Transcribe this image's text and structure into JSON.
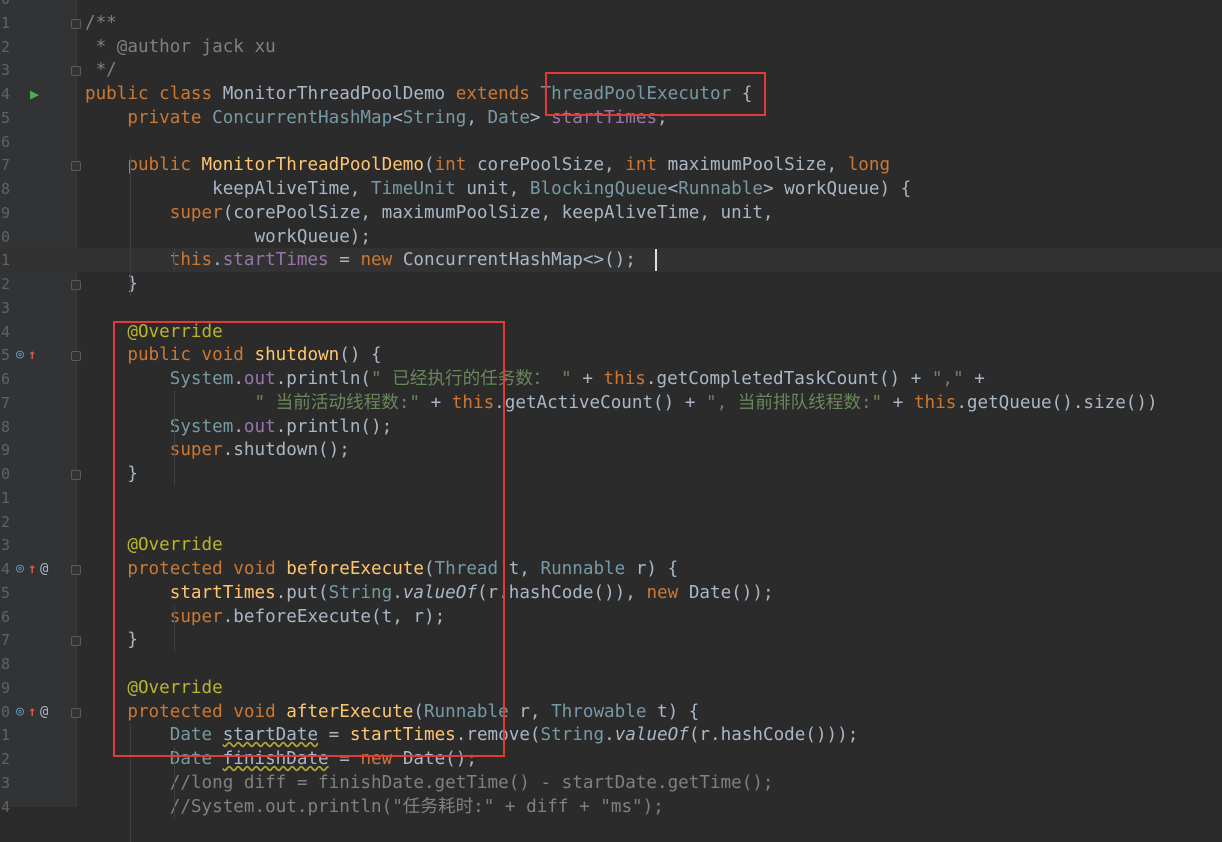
{
  "editor": {
    "lines": [
      {
        "n": "0",
        "tokens": []
      },
      {
        "n": "1",
        "tokens": [
          [
            "comment",
            "/**"
          ]
        ]
      },
      {
        "n": "2",
        "tokens": [
          [
            "comment",
            " * @author jack xu"
          ]
        ]
      },
      {
        "n": "3",
        "tokens": [
          [
            "comment",
            " */"
          ]
        ]
      },
      {
        "n": "4",
        "icons": [
          "run"
        ],
        "tokens": [
          [
            "keyword",
            "public class "
          ],
          [
            "plain",
            "MonitorThreadPoolDemo "
          ],
          [
            "keyword",
            "extends "
          ],
          [
            "class",
            "ThreadPoolExecutor"
          ],
          [
            "plain",
            " {"
          ]
        ]
      },
      {
        "n": "5",
        "tokens": [
          [
            "plain",
            "    "
          ],
          [
            "keyword",
            "private "
          ],
          [
            "class",
            "ConcurrentHashMap"
          ],
          [
            "plain",
            "<"
          ],
          [
            "class",
            "String"
          ],
          [
            "plain",
            ", "
          ],
          [
            "class",
            "Date"
          ],
          [
            "plain",
            "> "
          ],
          [
            "field",
            "startTimes"
          ],
          [
            "plain",
            ";"
          ]
        ]
      },
      {
        "n": "6",
        "tokens": []
      },
      {
        "n": "7",
        "tokens": [
          [
            "plain",
            "    "
          ],
          [
            "keyword",
            "public "
          ],
          [
            "method",
            "MonitorThreadPoolDemo"
          ],
          [
            "plain",
            "("
          ],
          [
            "keyword",
            "int "
          ],
          [
            "plain",
            "corePoolSize, "
          ],
          [
            "keyword",
            "int "
          ],
          [
            "plain",
            "maximumPoolSize, "
          ],
          [
            "keyword",
            "long"
          ]
        ]
      },
      {
        "n": "8",
        "tokens": [
          [
            "plain",
            "            keepAliveTime, "
          ],
          [
            "class",
            "TimeUnit"
          ],
          [
            "plain",
            " unit, "
          ],
          [
            "class",
            "BlockingQueue"
          ],
          [
            "plain",
            "<"
          ],
          [
            "class",
            "Runnable"
          ],
          [
            "plain",
            "> workQueue) {"
          ]
        ]
      },
      {
        "n": "9",
        "tokens": [
          [
            "plain",
            "        "
          ],
          [
            "keyword",
            "super"
          ],
          [
            "plain",
            "(corePoolSize, maximumPoolSize, keepAliveTime, unit,"
          ]
        ]
      },
      {
        "n": "0",
        "tokens": [
          [
            "plain",
            "                workQueue);"
          ]
        ]
      },
      {
        "n": "1",
        "current": true,
        "tokens": [
          [
            "plain",
            "        "
          ],
          [
            "keyword",
            "this"
          ],
          [
            "plain",
            "."
          ],
          [
            "field",
            "startTimes"
          ],
          [
            "plain",
            " = "
          ],
          [
            "keyword",
            "new "
          ],
          [
            "plain",
            "ConcurrentHashMap<>();"
          ]
        ]
      },
      {
        "n": "2",
        "tokens": [
          [
            "plain",
            "    }"
          ]
        ]
      },
      {
        "n": "3",
        "tokens": []
      },
      {
        "n": "4",
        "tokens": [
          [
            "plain",
            "    "
          ],
          [
            "annot",
            "@Override"
          ]
        ]
      },
      {
        "n": "5",
        "icons": [
          "ovr",
          "up"
        ],
        "tokens": [
          [
            "plain",
            "    "
          ],
          [
            "keyword",
            "public void "
          ],
          [
            "method",
            "shutdown"
          ],
          [
            "plain",
            "() {"
          ]
        ]
      },
      {
        "n": "6",
        "tokens": [
          [
            "plain",
            "        "
          ],
          [
            "class",
            "System"
          ],
          [
            "plain",
            "."
          ],
          [
            "field",
            "out"
          ],
          [
            "plain",
            ".println("
          ],
          [
            "string",
            "\" 已经执行的任务数： \""
          ],
          [
            "plain",
            " + "
          ],
          [
            "keyword",
            "this"
          ],
          [
            "plain",
            ".getCompletedTaskCount() + "
          ],
          [
            "string",
            "\",\""
          ],
          [
            "plain",
            " +"
          ]
        ]
      },
      {
        "n": "7",
        "tokens": [
          [
            "plain",
            "                "
          ],
          [
            "string",
            "\" 当前活动线程数:\""
          ],
          [
            "plain",
            " + "
          ],
          [
            "keyword",
            "this"
          ],
          [
            "plain",
            ".getActiveCount() + "
          ],
          [
            "string",
            "\", 当前排队线程数:\""
          ],
          [
            "plain",
            " + "
          ],
          [
            "keyword",
            "this"
          ],
          [
            "plain",
            ".getQueue().size())"
          ]
        ]
      },
      {
        "n": "8",
        "tokens": [
          [
            "plain",
            "        "
          ],
          [
            "class",
            "System"
          ],
          [
            "plain",
            "."
          ],
          [
            "field",
            "out"
          ],
          [
            "plain",
            ".println();"
          ]
        ]
      },
      {
        "n": "9",
        "tokens": [
          [
            "plain",
            "        "
          ],
          [
            "keyword",
            "super"
          ],
          [
            "plain",
            ".shutdown();"
          ]
        ]
      },
      {
        "n": "0",
        "tokens": [
          [
            "plain",
            "    }"
          ]
        ]
      },
      {
        "n": "1",
        "tokens": []
      },
      {
        "n": "2",
        "tokens": []
      },
      {
        "n": "3",
        "tokens": [
          [
            "plain",
            "    "
          ],
          [
            "annot",
            "@Override"
          ]
        ]
      },
      {
        "n": "4",
        "icons": [
          "ovr",
          "up",
          "at"
        ],
        "tokens": [
          [
            "plain",
            "    "
          ],
          [
            "keyword",
            "protected void "
          ],
          [
            "method",
            "beforeExecute"
          ],
          [
            "plain",
            "("
          ],
          [
            "class",
            "Thread"
          ],
          [
            "plain",
            " t, "
          ],
          [
            "class",
            "Runnable"
          ],
          [
            "plain",
            " r) {"
          ]
        ]
      },
      {
        "n": "5",
        "tokens": [
          [
            "plain",
            "        "
          ],
          [
            "method",
            "startTimes"
          ],
          [
            "plain",
            ".put("
          ],
          [
            "class",
            "String"
          ],
          [
            "plain",
            "."
          ],
          [
            "static",
            "valueOf"
          ],
          [
            "plain",
            "(r.hashCode()), "
          ],
          [
            "keyword",
            "new "
          ],
          [
            "plain",
            "Date());"
          ]
        ]
      },
      {
        "n": "6",
        "tokens": [
          [
            "plain",
            "        "
          ],
          [
            "keyword",
            "super"
          ],
          [
            "plain",
            ".beforeExecute(t, r);"
          ]
        ]
      },
      {
        "n": "7",
        "tokens": [
          [
            "plain",
            "    }"
          ]
        ]
      },
      {
        "n": "8",
        "tokens": []
      },
      {
        "n": "9",
        "tokens": [
          [
            "plain",
            "    "
          ],
          [
            "annot",
            "@Override"
          ]
        ]
      },
      {
        "n": "0",
        "icons": [
          "ovr",
          "up",
          "at"
        ],
        "tokens": [
          [
            "plain",
            "    "
          ],
          [
            "keyword",
            "protected void "
          ],
          [
            "method",
            "afterExecute"
          ],
          [
            "plain",
            "("
          ],
          [
            "class",
            "Runnable"
          ],
          [
            "plain",
            " r, "
          ],
          [
            "class",
            "Throwable"
          ],
          [
            "plain",
            " t) {"
          ]
        ]
      },
      {
        "n": "1",
        "tokens": [
          [
            "plain",
            "        "
          ],
          [
            "class",
            "Date "
          ],
          [
            "squig",
            "startDate"
          ],
          [
            "plain",
            " = "
          ],
          [
            "method",
            "startTimes"
          ],
          [
            "plain",
            ".remove("
          ],
          [
            "class",
            "String"
          ],
          [
            "plain",
            "."
          ],
          [
            "static",
            "valueOf"
          ],
          [
            "plain",
            "(r.hashCode()));"
          ]
        ]
      },
      {
        "n": "2",
        "tokens": [
          [
            "plain",
            "        "
          ],
          [
            "class",
            "Date "
          ],
          [
            "squig",
            "finishDate"
          ],
          [
            "plain",
            " = "
          ],
          [
            "keyword",
            "new "
          ],
          [
            "plain",
            "Date();"
          ]
        ]
      },
      {
        "n": "3",
        "tokens": [
          [
            "plain",
            "        "
          ],
          [
            "comment",
            "//long diff = finishDate.getTime() - startDate.getTime();"
          ]
        ]
      },
      {
        "n": "4",
        "tokens": [
          [
            "plain",
            "        "
          ],
          [
            "comment",
            "//System.out.println(\"任务耗时:\" + diff + \"ms\");"
          ]
        ]
      }
    ]
  },
  "gutter_icons": {
    "run": "run-icon",
    "ovr": "override-icon",
    "up": "implements-arrow-icon",
    "at": "annotation-icon"
  },
  "highlights": {
    "class_box": "ThreadPoolExecutor",
    "methods_box": "@Override methods"
  },
  "colors": {
    "background": "#2b2b2b",
    "keyword": "#cc7832",
    "string": "#6a8759",
    "method": "#ffc66d",
    "annotation": "#bbb529",
    "field": "#9876aa",
    "highlight_border": "#e53935"
  }
}
